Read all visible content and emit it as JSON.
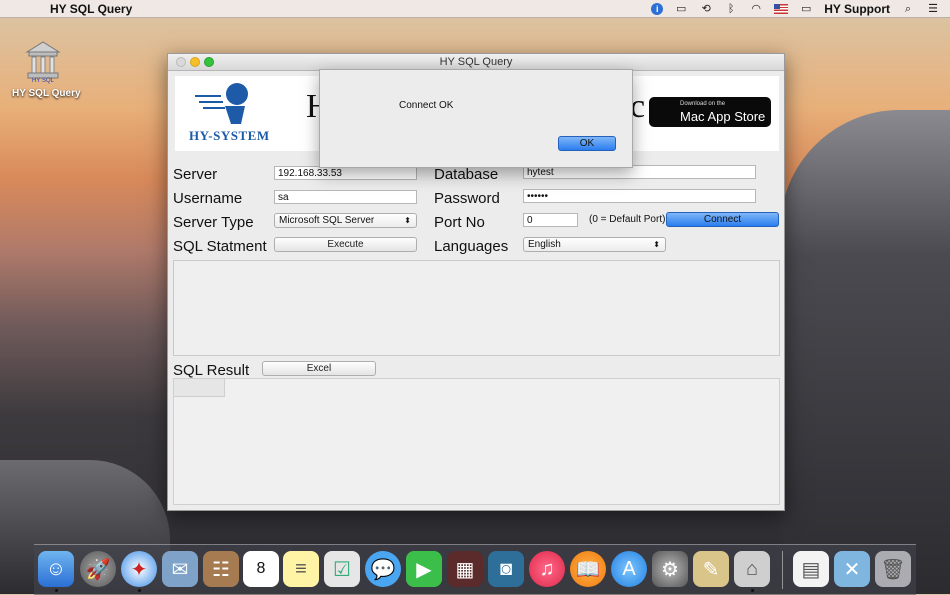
{
  "menubar": {
    "app_name": "HY SQL Query",
    "support_label": "HY Support",
    "icons": [
      "apple-icon",
      "info-icon",
      "airplay-icon",
      "time-machine-icon",
      "bluetooth-icon",
      "wifi-icon",
      "flag-icon",
      "battery-icon",
      "search-icon",
      "list-icon"
    ]
  },
  "desktop": {
    "icon_label": "HY SQL Query",
    "icon_badge": "HY SQL"
  },
  "window": {
    "title": "HY SQL Query",
    "banner": {
      "logo_text": "HY-SYSTEM",
      "title_left": "H",
      "title_right": "c",
      "store_small": "Download on the",
      "store_large": "Mac App Store"
    },
    "labels": {
      "server": "Server",
      "username": "Username",
      "server_type": "Server Type",
      "sql_statement": "SQL Statment",
      "database": "Database",
      "password": "Password",
      "port": "Port No",
      "languages": "Languages",
      "sql_result": "SQL Result",
      "default_port": "(0 = Default Port)"
    },
    "values": {
      "server": "192.168.33.53",
      "username": "sa",
      "server_type": "Microsoft SQL Server",
      "database": "hytest",
      "password": "••••••",
      "port": "0",
      "language": "English"
    },
    "buttons": {
      "execute": "Execute",
      "connect": "Connect",
      "excel": "Excel"
    }
  },
  "dialog": {
    "message": "Connect OK",
    "ok_label": "OK"
  }
}
